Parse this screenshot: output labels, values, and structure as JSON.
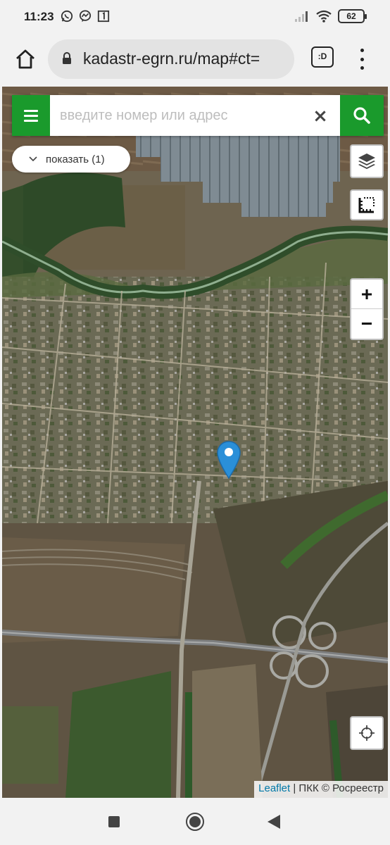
{
  "status_bar": {
    "time": "11:23",
    "battery": "62",
    "left_icons": [
      "whatsapp-icon",
      "messenger-icon",
      "notification-box-icon"
    ],
    "right_icons": [
      "signal-icon",
      "wifi-icon",
      "battery-icon"
    ]
  },
  "browser": {
    "url": "kadastr-egrn.ru/map#ct=",
    "tab_switcher_label": ":D"
  },
  "map": {
    "search": {
      "placeholder": "введите номер или адрес",
      "clear_symbol": "×"
    },
    "show_button_label": "показать (1)",
    "zoom_in_label": "+",
    "zoom_out_label": "−",
    "attribution": {
      "link_text": "Leaflet",
      "separator": " | ",
      "source_text": "ПКК © Росреестр"
    },
    "colors": {
      "accent_green": "#1a9a2c",
      "marker_blue": "#2a8fd8",
      "link_blue": "#0078a8"
    }
  },
  "nav_bar": {
    "buttons": [
      "recents-button",
      "home-button",
      "back-button"
    ]
  }
}
